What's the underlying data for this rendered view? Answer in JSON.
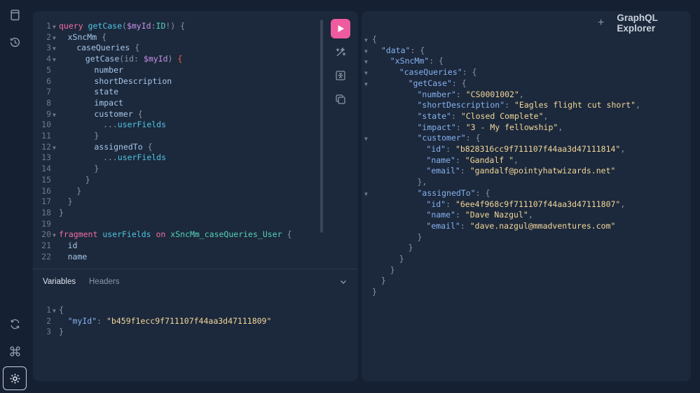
{
  "sidebar": {
    "icons": [
      "docs-icon",
      "history-icon",
      "refetch-icon",
      "shortcuts-icon",
      "settings-icon"
    ]
  },
  "editor": {
    "run_button_label": "Run",
    "tools": [
      "prettify-icon",
      "merge-icon",
      "copy-icon"
    ]
  },
  "query_lines": [
    {
      "n": "1",
      "fold": true,
      "indent": 0,
      "tokens": [
        [
          "kw",
          "query "
        ],
        [
          "def",
          "getCase"
        ],
        [
          "punc",
          "("
        ],
        [
          "var",
          "$myId"
        ],
        [
          "punc",
          ":"
        ],
        [
          "typ",
          "ID"
        ],
        [
          "punc",
          "!) {"
        ]
      ]
    },
    {
      "n": "2",
      "fold": true,
      "indent": 1,
      "tokens": [
        [
          "fld",
          "xSncMm"
        ],
        [
          "punc",
          " {"
        ]
      ]
    },
    {
      "n": "3",
      "fold": true,
      "indent": 2,
      "tokens": [
        [
          "fld",
          "caseQueries"
        ],
        [
          "punc",
          " {"
        ]
      ]
    },
    {
      "n": "4",
      "fold": true,
      "indent": 3,
      "tokens": [
        [
          "fld",
          "getCase"
        ],
        [
          "punc",
          "(id: "
        ],
        [
          "var",
          "$myId"
        ],
        [
          "punc",
          ") "
        ],
        [
          "err",
          "{"
        ]
      ]
    },
    {
      "n": "5",
      "fold": false,
      "indent": 4,
      "tokens": [
        [
          "fld",
          "number"
        ]
      ]
    },
    {
      "n": "6",
      "fold": false,
      "indent": 4,
      "tokens": [
        [
          "fld",
          "shortDescription"
        ]
      ]
    },
    {
      "n": "7",
      "fold": false,
      "indent": 4,
      "tokens": [
        [
          "fld",
          "state"
        ]
      ]
    },
    {
      "n": "8",
      "fold": false,
      "indent": 4,
      "tokens": [
        [
          "fld",
          "impact"
        ]
      ]
    },
    {
      "n": "9",
      "fold": true,
      "indent": 4,
      "tokens": [
        [
          "fld",
          "customer"
        ],
        [
          "punc",
          " {"
        ]
      ]
    },
    {
      "n": "10",
      "fold": false,
      "indent": 5,
      "tokens": [
        [
          "punc",
          "..."
        ],
        [
          "def",
          "userFields"
        ]
      ]
    },
    {
      "n": "11",
      "fold": false,
      "indent": 4,
      "tokens": [
        [
          "punc",
          "}"
        ]
      ]
    },
    {
      "n": "12",
      "fold": true,
      "indent": 4,
      "tokens": [
        [
          "fld",
          "assignedTo"
        ],
        [
          "punc",
          " {"
        ]
      ]
    },
    {
      "n": "13",
      "fold": false,
      "indent": 5,
      "tokens": [
        [
          "punc",
          "..."
        ],
        [
          "def",
          "userFields"
        ]
      ]
    },
    {
      "n": "14",
      "fold": false,
      "indent": 4,
      "tokens": [
        [
          "punc",
          "}"
        ]
      ]
    },
    {
      "n": "15",
      "fold": false,
      "indent": 3,
      "tokens": [
        [
          "punc",
          "}"
        ]
      ]
    },
    {
      "n": "16",
      "fold": false,
      "indent": 2,
      "tokens": [
        [
          "punc",
          "}"
        ]
      ]
    },
    {
      "n": "17",
      "fold": false,
      "indent": 1,
      "tokens": [
        [
          "punc",
          "}"
        ]
      ]
    },
    {
      "n": "18",
      "fold": false,
      "indent": 0,
      "tokens": [
        [
          "punc",
          "}"
        ]
      ]
    },
    {
      "n": "19",
      "fold": false,
      "indent": 0,
      "tokens": []
    },
    {
      "n": "20",
      "fold": true,
      "indent": 0,
      "tokens": [
        [
          "kw",
          "fragment "
        ],
        [
          "def",
          "userFields"
        ],
        [
          "kw",
          " on "
        ],
        [
          "typ",
          "xSncMm_caseQueries_User"
        ],
        [
          "punc",
          " {"
        ]
      ]
    },
    {
      "n": "21",
      "fold": false,
      "indent": 1,
      "tokens": [
        [
          "fld",
          "id"
        ]
      ]
    },
    {
      "n": "22",
      "fold": false,
      "indent": 1,
      "tokens": [
        [
          "fld",
          "name"
        ]
      ]
    }
  ],
  "tabs": {
    "variables": "Variables",
    "headers": "Headers"
  },
  "variables_lines": [
    {
      "n": "1",
      "fold": true,
      "indent": 0,
      "tokens": [
        [
          "punc",
          "{"
        ]
      ]
    },
    {
      "n": "2",
      "fold": false,
      "indent": 1,
      "tokens": [
        [
          "prop",
          "\"myId\""
        ],
        [
          "punc",
          ": "
        ],
        [
          "str",
          "\"b459f1ecc9f711107f44aa3d47111809\""
        ]
      ]
    },
    {
      "n": "3",
      "fold": false,
      "indent": 0,
      "tokens": [
        [
          "punc",
          "}"
        ]
      ]
    }
  ],
  "explorer": {
    "plus": "+",
    "title": "GraphQL Explorer"
  },
  "result_lines": [
    {
      "fold": true,
      "indent": 0,
      "tokens": [
        [
          "punc",
          "{"
        ]
      ]
    },
    {
      "fold": true,
      "indent": 1,
      "tokens": [
        [
          "prop",
          "\"data\""
        ],
        [
          "punc",
          ": {"
        ]
      ]
    },
    {
      "fold": true,
      "indent": 2,
      "tokens": [
        [
          "prop",
          "\"xSncMm\""
        ],
        [
          "punc",
          ": {"
        ]
      ]
    },
    {
      "fold": true,
      "indent": 3,
      "tokens": [
        [
          "prop",
          "\"caseQueries\""
        ],
        [
          "punc",
          ": {"
        ]
      ]
    },
    {
      "fold": true,
      "indent": 4,
      "tokens": [
        [
          "prop",
          "\"getCase\""
        ],
        [
          "punc",
          ": {"
        ]
      ]
    },
    {
      "fold": false,
      "indent": 5,
      "tokens": [
        [
          "prop",
          "\"number\""
        ],
        [
          "punc",
          ": "
        ],
        [
          "str",
          "\"CS0001002\""
        ],
        [
          "punc",
          ","
        ]
      ]
    },
    {
      "fold": false,
      "indent": 5,
      "tokens": [
        [
          "prop",
          "\"shortDescription\""
        ],
        [
          "punc",
          ": "
        ],
        [
          "str",
          "\"Eagles flight cut short\""
        ],
        [
          "punc",
          ","
        ]
      ]
    },
    {
      "fold": false,
      "indent": 5,
      "tokens": [
        [
          "prop",
          "\"state\""
        ],
        [
          "punc",
          ": "
        ],
        [
          "str",
          "\"Closed Complete\""
        ],
        [
          "punc",
          ","
        ]
      ]
    },
    {
      "fold": false,
      "indent": 5,
      "tokens": [
        [
          "prop",
          "\"impact\""
        ],
        [
          "punc",
          ": "
        ],
        [
          "str",
          "\"3 - My fellowship\""
        ],
        [
          "punc",
          ","
        ]
      ]
    },
    {
      "fold": true,
      "indent": 5,
      "tokens": [
        [
          "prop",
          "\"customer\""
        ],
        [
          "punc",
          ": {"
        ]
      ]
    },
    {
      "fold": false,
      "indent": 6,
      "tokens": [
        [
          "prop",
          "\"id\""
        ],
        [
          "punc",
          ": "
        ],
        [
          "str",
          "\"b828316cc9f711107f44aa3d47111814\""
        ],
        [
          "punc",
          ","
        ]
      ]
    },
    {
      "fold": false,
      "indent": 6,
      "tokens": [
        [
          "prop",
          "\"name\""
        ],
        [
          "punc",
          ": "
        ],
        [
          "str",
          "\"Gandalf \""
        ],
        [
          "punc",
          ","
        ]
      ]
    },
    {
      "fold": false,
      "indent": 6,
      "tokens": [
        [
          "prop",
          "\"email\""
        ],
        [
          "punc",
          ": "
        ],
        [
          "str",
          "\"gandalf@pointyhatwizards.net\""
        ]
      ]
    },
    {
      "fold": false,
      "indent": 5,
      "tokens": [
        [
          "punc",
          "},"
        ]
      ]
    },
    {
      "fold": true,
      "indent": 5,
      "tokens": [
        [
          "prop",
          "\"assignedTo\""
        ],
        [
          "punc",
          ": {"
        ]
      ]
    },
    {
      "fold": false,
      "indent": 6,
      "tokens": [
        [
          "prop",
          "\"id\""
        ],
        [
          "punc",
          ": "
        ],
        [
          "str",
          "\"6ee4f968c9f711107f44aa3d47111807\""
        ],
        [
          "punc",
          ","
        ]
      ]
    },
    {
      "fold": false,
      "indent": 6,
      "tokens": [
        [
          "prop",
          "\"name\""
        ],
        [
          "punc",
          ": "
        ],
        [
          "str",
          "\"Dave Nazgul\""
        ],
        [
          "punc",
          ","
        ]
      ]
    },
    {
      "fold": false,
      "indent": 6,
      "tokens": [
        [
          "prop",
          "\"email\""
        ],
        [
          "punc",
          ": "
        ],
        [
          "str",
          "\"dave.nazgul@mmadventures.com\""
        ]
      ]
    },
    {
      "fold": false,
      "indent": 5,
      "tokens": [
        [
          "punc",
          "}"
        ]
      ]
    },
    {
      "fold": false,
      "indent": 4,
      "tokens": [
        [
          "punc",
          "}"
        ]
      ]
    },
    {
      "fold": false,
      "indent": 3,
      "tokens": [
        [
          "punc",
          "}"
        ]
      ]
    },
    {
      "fold": false,
      "indent": 2,
      "tokens": [
        [
          "punc",
          "}"
        ]
      ]
    },
    {
      "fold": false,
      "indent": 1,
      "tokens": [
        [
          "punc",
          "}"
        ]
      ]
    },
    {
      "fold": false,
      "indent": 0,
      "tokens": [
        [
          "punc",
          "}"
        ]
      ]
    }
  ]
}
